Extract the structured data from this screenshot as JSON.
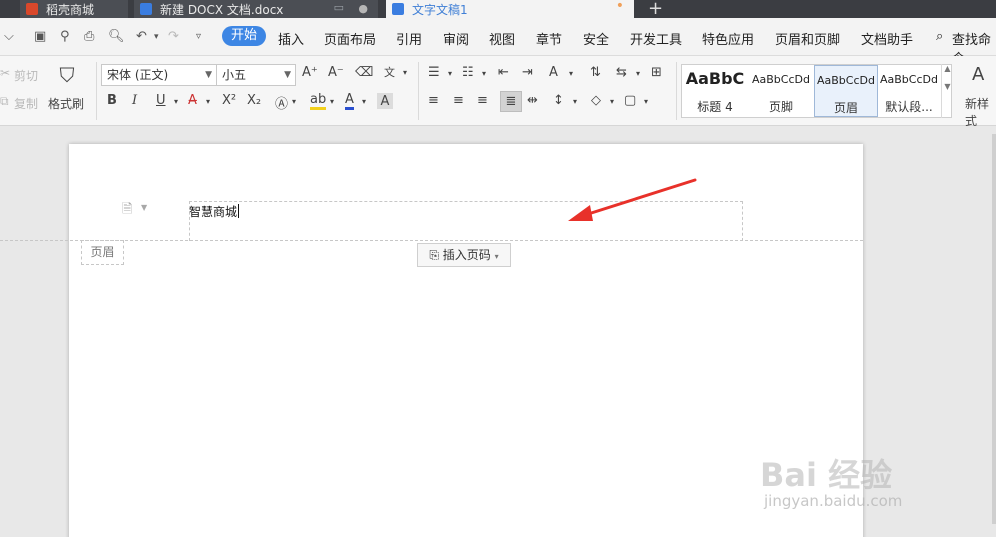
{
  "tabs": [
    {
      "label": "稻壳商城"
    },
    {
      "label": "新建 DOCX 文档.docx"
    },
    {
      "label": "文字文稿1"
    }
  ],
  "menu": {
    "active": "开始",
    "items": [
      "插入",
      "页面布局",
      "引用",
      "审阅",
      "视图",
      "章节",
      "安全",
      "开发工具",
      "特色应用",
      "页眉和页脚",
      "文档助手"
    ],
    "search_label": "查找命令"
  },
  "ribbon": {
    "cut_label": "剪切",
    "copy_label": "复制",
    "format_painter_label": "格式刷",
    "font_name": "宋体 (正文)",
    "font_size": "小五",
    "new_style_label": "新样式",
    "styles": [
      {
        "sample": "AaBbC",
        "name": "标题 4"
      },
      {
        "sample": "AaBbCcDd",
        "name": "页脚"
      },
      {
        "sample": "AaBbCcDd",
        "name": "页眉"
      },
      {
        "sample": "AaBbCcDd",
        "name": "默认段..."
      }
    ]
  },
  "document": {
    "header_text": "智慧商城",
    "header_label": "页眉",
    "insert_page_number_label": "插入页码"
  },
  "watermark": {
    "main": "Bai  经验",
    "sub": "jingyan.baidu.com"
  },
  "colors": {
    "accent": "#3d86e4",
    "annotation_arrow": "#e8312a"
  }
}
